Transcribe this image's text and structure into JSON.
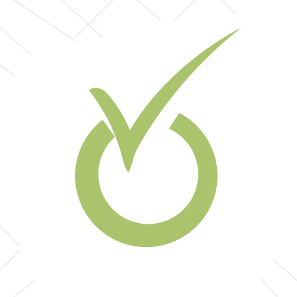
{
  "colors": {
    "background": "#ffffff",
    "mark": "#a9c46c",
    "watermark_lines": "#e9e9e9"
  },
  "logo": {
    "icon": "checkmark-in-ring-icon"
  }
}
